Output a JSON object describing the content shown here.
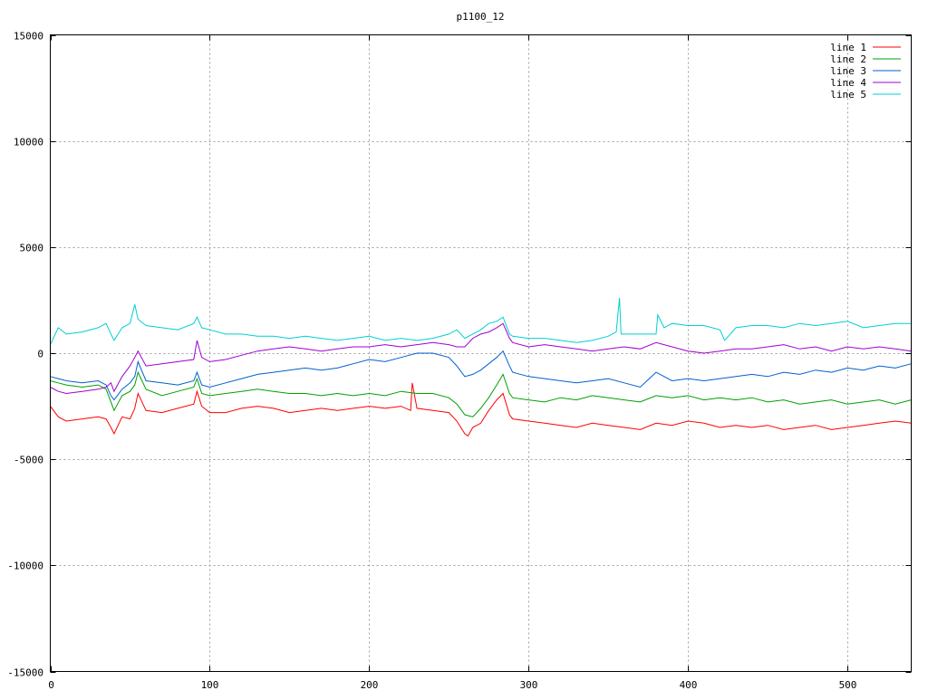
{
  "chart_data": {
    "type": "line",
    "title": "p1100_12",
    "xlabel": "",
    "ylabel": "",
    "xlim": [
      0,
      540
    ],
    "ylim": [
      -15000,
      15000
    ],
    "x_ticks": [
      0,
      100,
      200,
      300,
      400,
      500
    ],
    "y_ticks": [
      -15000,
      -10000,
      -5000,
      0,
      5000,
      10000,
      15000
    ],
    "grid": true,
    "legend_position": "top-right",
    "series": [
      {
        "name": "line 1",
        "color": "#ff0000",
        "x": [
          0,
          5,
          10,
          20,
          30,
          35,
          38,
          40,
          45,
          50,
          53,
          55,
          60,
          70,
          80,
          90,
          92,
          95,
          100,
          110,
          120,
          130,
          140,
          150,
          160,
          170,
          180,
          190,
          200,
          210,
          220,
          226,
          227,
          230,
          240,
          250,
          255,
          260,
          262,
          265,
          270,
          275,
          280,
          284,
          288,
          290,
          300,
          310,
          320,
          330,
          340,
          350,
          360,
          370,
          380,
          390,
          400,
          410,
          420,
          430,
          440,
          450,
          460,
          470,
          480,
          490,
          500,
          510,
          520,
          530,
          540
        ],
        "y": [
          -2500,
          -3000,
          -3200,
          -3100,
          -3000,
          -3100,
          -3500,
          -3800,
          -3000,
          -3100,
          -2600,
          -1900,
          -2700,
          -2800,
          -2600,
          -2400,
          -1800,
          -2500,
          -2800,
          -2800,
          -2600,
          -2500,
          -2600,
          -2800,
          -2700,
          -2600,
          -2700,
          -2600,
          -2500,
          -2600,
          -2500,
          -2700,
          -1400,
          -2600,
          -2700,
          -2800,
          -3200,
          -3800,
          -3900,
          -3500,
          -3300,
          -2700,
          -2200,
          -1900,
          -2900,
          -3100,
          -3200,
          -3300,
          -3400,
          -3500,
          -3300,
          -3400,
          -3500,
          -3600,
          -3300,
          -3400,
          -3200,
          -3300,
          -3500,
          -3400,
          -3500,
          -3400,
          -3600,
          -3500,
          -3400,
          -3600,
          -3500,
          -3400,
          -3300,
          -3200,
          -3300
        ]
      },
      {
        "name": "line 2",
        "color": "#00a000",
        "x": [
          0,
          5,
          10,
          20,
          30,
          35,
          38,
          40,
          45,
          50,
          53,
          55,
          60,
          70,
          80,
          90,
          92,
          95,
          100,
          110,
          120,
          130,
          140,
          150,
          160,
          170,
          180,
          190,
          200,
          210,
          220,
          230,
          240,
          250,
          255,
          260,
          265,
          270,
          275,
          280,
          284,
          288,
          290,
          300,
          310,
          320,
          330,
          340,
          350,
          360,
          370,
          380,
          390,
          400,
          410,
          420,
          430,
          440,
          450,
          460,
          470,
          480,
          490,
          500,
          510,
          520,
          530,
          540
        ],
        "y": [
          -1300,
          -1400,
          -1500,
          -1600,
          -1500,
          -1700,
          -2300,
          -2700,
          -2000,
          -1800,
          -1500,
          -900,
          -1700,
          -2000,
          -1800,
          -1600,
          -1200,
          -1900,
          -2000,
          -1900,
          -1800,
          -1700,
          -1800,
          -1900,
          -1900,
          -2000,
          -1900,
          -2000,
          -1900,
          -2000,
          -1800,
          -1900,
          -1900,
          -2100,
          -2400,
          -2900,
          -3000,
          -2600,
          -2100,
          -1500,
          -1000,
          -1900,
          -2100,
          -2200,
          -2300,
          -2100,
          -2200,
          -2000,
          -2100,
          -2200,
          -2300,
          -2000,
          -2100,
          -2000,
          -2200,
          -2100,
          -2200,
          -2100,
          -2300,
          -2200,
          -2400,
          -2300,
          -2200,
          -2400,
          -2300,
          -2200,
          -2400,
          -2200
        ]
      },
      {
        "name": "line 3",
        "color": "#0060d0",
        "x": [
          0,
          5,
          10,
          20,
          30,
          35,
          38,
          40,
          45,
          50,
          53,
          55,
          60,
          70,
          80,
          90,
          92,
          95,
          100,
          110,
          120,
          130,
          140,
          150,
          160,
          170,
          180,
          190,
          200,
          210,
          220,
          230,
          240,
          250,
          255,
          260,
          265,
          270,
          275,
          280,
          284,
          288,
          290,
          300,
          310,
          320,
          330,
          340,
          350,
          360,
          370,
          380,
          390,
          400,
          410,
          420,
          430,
          440,
          450,
          460,
          470,
          480,
          490,
          500,
          510,
          520,
          530,
          540
        ],
        "y": [
          -1100,
          -1200,
          -1300,
          -1400,
          -1300,
          -1500,
          -2000,
          -2200,
          -1700,
          -1400,
          -1100,
          -400,
          -1300,
          -1400,
          -1500,
          -1300,
          -900,
          -1500,
          -1600,
          -1400,
          -1200,
          -1000,
          -900,
          -800,
          -700,
          -800,
          -700,
          -500,
          -300,
          -400,
          -200,
          0,
          0,
          -200,
          -600,
          -1100,
          -1000,
          -800,
          -500,
          -200,
          100,
          -600,
          -900,
          -1100,
          -1200,
          -1300,
          -1400,
          -1300,
          -1200,
          -1400,
          -1600,
          -900,
          -1300,
          -1200,
          -1300,
          -1200,
          -1100,
          -1000,
          -1100,
          -900,
          -1000,
          -800,
          -900,
          -700,
          -800,
          -600,
          -700,
          -500
        ]
      },
      {
        "name": "line 4",
        "color": "#a000d0",
        "x": [
          0,
          5,
          10,
          20,
          30,
          35,
          38,
          40,
          45,
          50,
          53,
          55,
          60,
          70,
          80,
          90,
          92,
          95,
          100,
          110,
          120,
          130,
          140,
          150,
          160,
          170,
          180,
          190,
          200,
          210,
          220,
          230,
          240,
          250,
          255,
          260,
          265,
          270,
          275,
          280,
          284,
          288,
          290,
          300,
          310,
          320,
          330,
          340,
          350,
          360,
          370,
          380,
          390,
          400,
          410,
          420,
          430,
          440,
          450,
          460,
          470,
          480,
          490,
          500,
          510,
          520,
          530,
          540
        ],
        "y": [
          -1600,
          -1800,
          -1900,
          -1800,
          -1700,
          -1600,
          -1400,
          -1800,
          -1100,
          -600,
          -200,
          100,
          -600,
          -500,
          -400,
          -300,
          600,
          -200,
          -400,
          -300,
          -100,
          100,
          200,
          300,
          200,
          100,
          200,
          300,
          300,
          400,
          300,
          400,
          500,
          400,
          300,
          300,
          700,
          900,
          1000,
          1200,
          1400,
          700,
          500,
          300,
          400,
          300,
          200,
          100,
          200,
          300,
          200,
          500,
          300,
          100,
          0,
          100,
          200,
          200,
          300,
          400,
          200,
          300,
          100,
          300,
          200,
          300,
          200,
          100
        ]
      },
      {
        "name": "line 5",
        "color": "#00d0d0",
        "x": [
          0,
          5,
          10,
          20,
          30,
          35,
          38,
          40,
          45,
          50,
          53,
          55,
          60,
          70,
          80,
          90,
          92,
          95,
          100,
          110,
          120,
          130,
          140,
          150,
          160,
          170,
          180,
          190,
          200,
          210,
          220,
          230,
          240,
          250,
          255,
          260,
          265,
          270,
          275,
          280,
          284,
          288,
          290,
          300,
          310,
          320,
          330,
          340,
          350,
          355,
          357,
          358,
          360,
          370,
          380,
          381,
          385,
          390,
          400,
          410,
          420,
          423,
          430,
          440,
          450,
          460,
          470,
          480,
          490,
          500,
          510,
          520,
          530,
          540
        ],
        "y": [
          400,
          1200,
          900,
          1000,
          1200,
          1400,
          900,
          600,
          1200,
          1400,
          2300,
          1600,
          1300,
          1200,
          1100,
          1400,
          1700,
          1200,
          1100,
          900,
          900,
          800,
          800,
          700,
          800,
          700,
          600,
          700,
          800,
          600,
          700,
          600,
          700,
          900,
          1100,
          700,
          900,
          1100,
          1400,
          1500,
          1700,
          900,
          800,
          700,
          700,
          600,
          500,
          600,
          800,
          1000,
          2600,
          900,
          900,
          900,
          900,
          1800,
          1200,
          1400,
          1300,
          1300,
          1100,
          600,
          1200,
          1300,
          1300,
          1200,
          1400,
          1300,
          1400,
          1500,
          1200,
          1300,
          1400,
          1400
        ]
      }
    ]
  }
}
